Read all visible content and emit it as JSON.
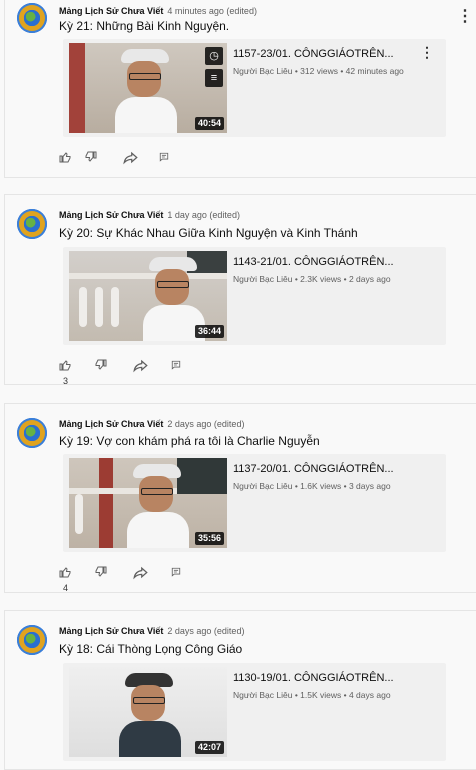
{
  "comments": [
    {
      "author": "Mảng Lịch Sử Chưa Viết",
      "meta": "4 minutes ago (edited)",
      "text": "Kỳ 21: Những Bài Kinh Nguyện.",
      "video": {
        "title": "1157-23/01. CÔNGGIÁOTRÊN...",
        "meta": "Người Bạc Liêu • 312 views • 42 minutes ago",
        "duration": "40:54"
      },
      "like_count": ""
    },
    {
      "author": "Mảng Lịch Sử Chưa Viết",
      "meta": "1 day ago (edited)",
      "text": "Kỳ 20: Sự Khác Nhau Giữa Kinh Nguyện và Kinh Thánh",
      "video": {
        "title": "1143-21/01. CÔNGGIÁOTRÊN...",
        "meta": "Người Bạc Liêu • 2.3K views • 2 days ago",
        "duration": "36:44"
      },
      "like_count": "3"
    },
    {
      "author": "Mảng Lịch Sử Chưa Viết",
      "meta": "2 days ago (edited)",
      "text": "Kỳ 19: Vợ con khám phá ra tôi là Charlie Nguyễn",
      "video": {
        "title": "1137-20/01. CÔNGGIÁOTRÊN...",
        "meta": "Người Bạc Liêu • 1.6K views • 3 days ago",
        "duration": "35:56"
      },
      "like_count": "4"
    },
    {
      "author": "Mảng Lịch Sử Chưa Viết",
      "meta": "2 days ago (edited)",
      "text": "Kỳ 18: Cái Thòng Lọng Công Giáo",
      "video": {
        "title": "1130-19/01. CÔNGGIÁOTRÊN...",
        "meta": "Người Bạc Liêu • 1.5K views • 4 days ago",
        "duration": "42:07"
      },
      "like_count": ""
    }
  ],
  "icons": {
    "menu": "more-vert-icon",
    "like": "thumb-up-icon",
    "dislike": "thumb-down-icon",
    "share": "share-icon",
    "reply": "reply-icon",
    "watch_later": "clock-icon",
    "add_to_queue": "queue-icon"
  }
}
